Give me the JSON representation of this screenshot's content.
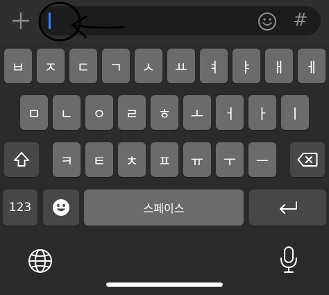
{
  "input_bar": {
    "plus_icon": "plus-icon",
    "emoji_icon": "emoji-icon",
    "hash_label": "#",
    "cursor_color": "#3b82f6"
  },
  "keyboard": {
    "row1": [
      "ㅂ",
      "ㅈ",
      "ㄷ",
      "ㄱ",
      "ㅅ",
      "ㅛ",
      "ㅕ",
      "ㅑ",
      "ㅐ",
      "ㅔ"
    ],
    "row2": [
      "ㅁ",
      "ㄴ",
      "ㅇ",
      "ㄹ",
      "ㅎ",
      "ㅗ",
      "ㅓ",
      "ㅏ",
      "ㅣ"
    ],
    "row3": [
      "ㅋ",
      "ㅌ",
      "ㅊ",
      "ㅍ",
      "ㅠ",
      "ㅜ",
      "ㅡ"
    ],
    "numbers_label": "123",
    "space_label": "스페이스",
    "shift_icon": "shift-icon",
    "backspace_icon": "backspace-icon",
    "emoji_key_icon": "emoji-icon",
    "return_icon": "return-icon",
    "globe_icon": "globe-icon",
    "mic_icon": "microphone-icon"
  },
  "colors": {
    "background": "#2b2b2b",
    "key": "#6b6b6b",
    "key_dark": "#474747",
    "input_field": "#1c1c1e"
  }
}
